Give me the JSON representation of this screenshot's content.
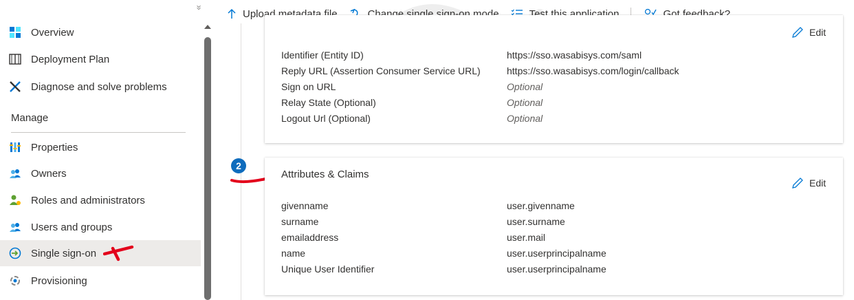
{
  "sidebar": {
    "items_top": [
      {
        "label": "Overview",
        "icon": "overview-grid-icon"
      },
      {
        "label": "Deployment Plan",
        "icon": "book-icon"
      },
      {
        "label": "Diagnose and solve problems",
        "icon": "wrench-icon"
      }
    ],
    "section_heading": "Manage",
    "items_manage": [
      {
        "label": "Properties",
        "icon": "properties-bars-icon"
      },
      {
        "label": "Owners",
        "icon": "people-icon"
      },
      {
        "label": "Roles and administrators",
        "icon": "roles-icon"
      },
      {
        "label": "Users and groups",
        "icon": "people-icon"
      },
      {
        "label": "Single sign-on",
        "icon": "sso-icon",
        "selected": true
      },
      {
        "label": "Provisioning",
        "icon": "provisioning-icon"
      }
    ]
  },
  "toolbar": {
    "upload_label": "Upload metadata file",
    "change_sso_label": "Change single sign-on mode",
    "test_label": "Test this application",
    "feedback_label": "Got feedback?"
  },
  "saml_config": {
    "edit_label": "Edit",
    "rows": [
      {
        "key": "Identifier (Entity ID)",
        "value": "https://sso.wasabisys.com/saml",
        "optional": false
      },
      {
        "key": "Reply URL (Assertion Consumer Service URL)",
        "value": "https://sso.wasabisys.com/login/callback",
        "optional": false
      },
      {
        "key": "Sign on URL",
        "value": "Optional",
        "optional": true
      },
      {
        "key": "Relay State (Optional)",
        "value": "Optional",
        "optional": true
      },
      {
        "key": "Logout Url (Optional)",
        "value": "Optional",
        "optional": true
      }
    ]
  },
  "attributes": {
    "step_number": "2",
    "title": "Attributes & Claims",
    "edit_label": "Edit",
    "rows": [
      {
        "key": "givenname",
        "value": "user.givenname"
      },
      {
        "key": "surname",
        "value": "user.surname"
      },
      {
        "key": "emailaddress",
        "value": "user.mail"
      },
      {
        "key": "name",
        "value": "user.userprincipalname"
      },
      {
        "key": "Unique User Identifier",
        "value": "user.userprincipalname"
      }
    ]
  },
  "colors": {
    "accent": "#0078d4",
    "annotation_red": "#e3001b",
    "selected_bg": "#edebe9"
  }
}
